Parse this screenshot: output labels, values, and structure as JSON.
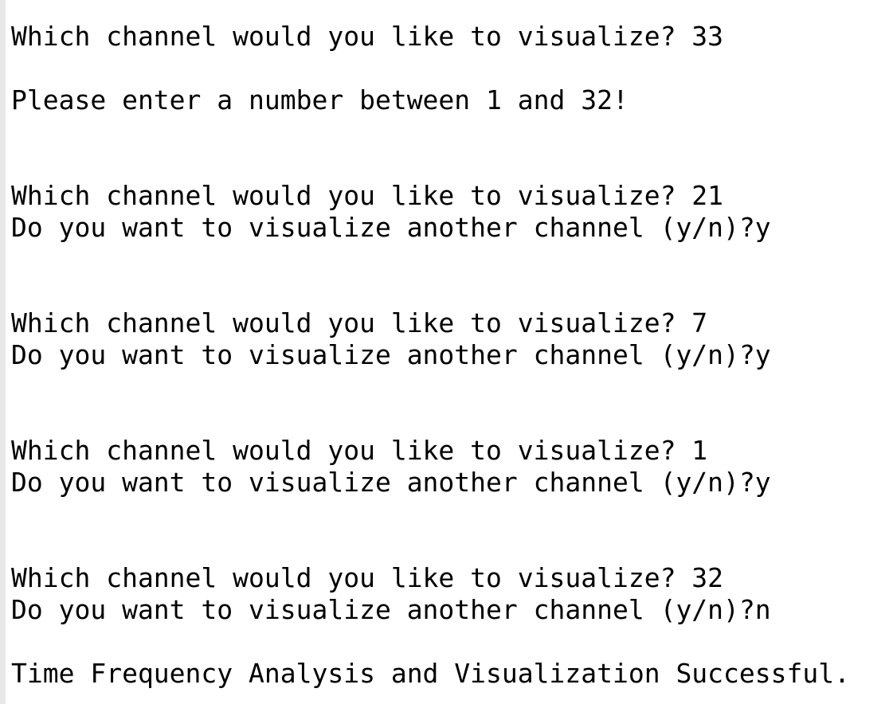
{
  "console": {
    "lines": [
      "Which channel would you like to visualize? 33",
      "Please enter a number between 1 and 32!",
      "Which channel would you like to visualize? 21",
      "Do you want to visualize another channel (y/n)?y",
      "Which channel would you like to visualize? 7",
      "Do you want to visualize another channel (y/n)?y",
      "Which channel would you like to visualize? 1",
      "Do you want to visualize another channel (y/n)?y",
      "Which channel would you like to visualize? 32",
      "Do you want to visualize another channel (y/n)?n",
      "Time Frequency Analysis and Visualization Successful."
    ]
  }
}
